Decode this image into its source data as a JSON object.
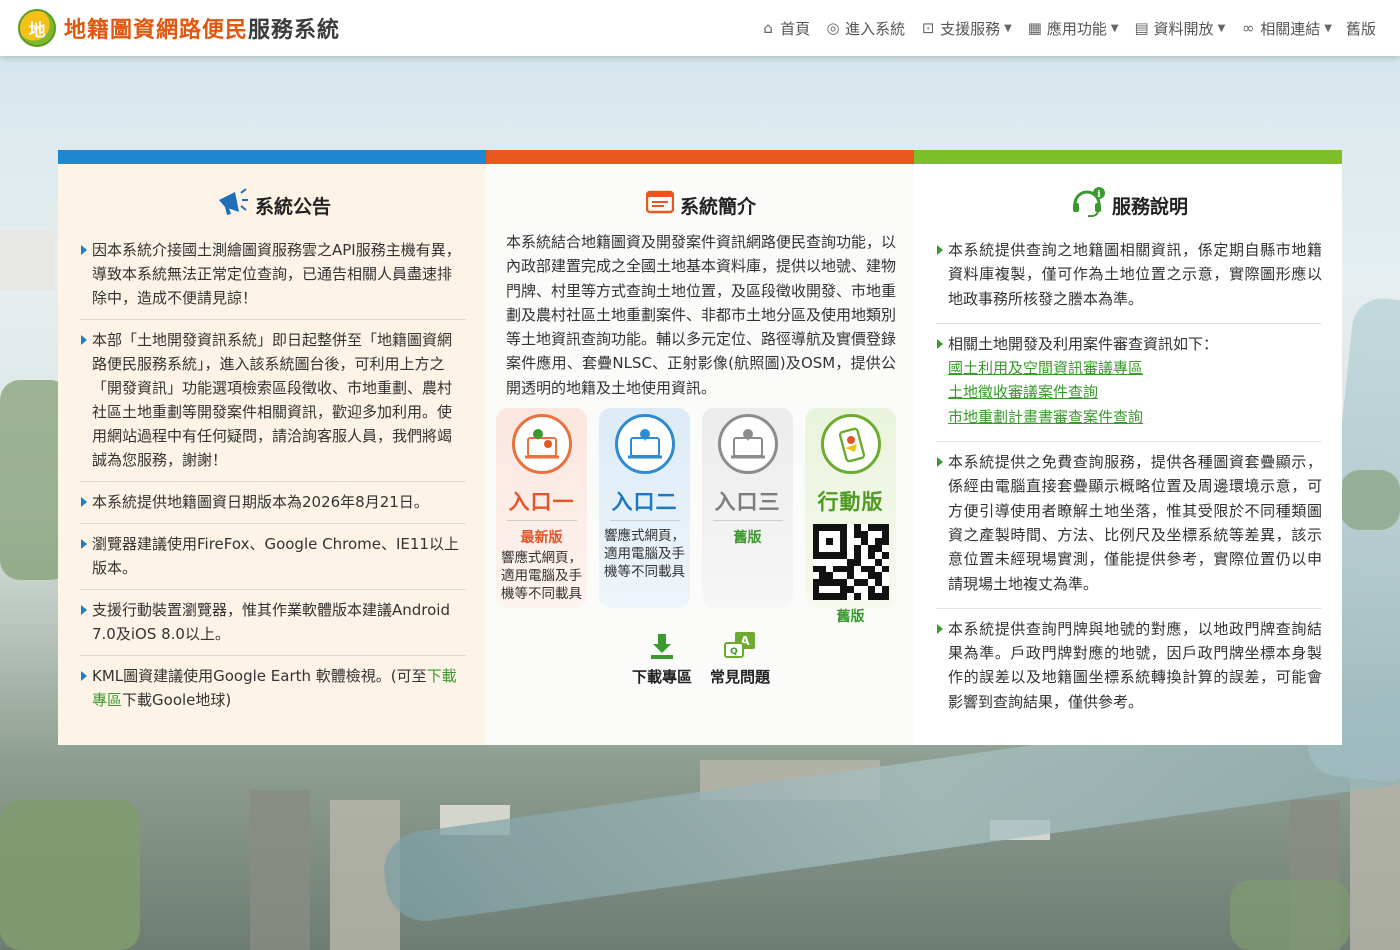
{
  "header": {
    "logo_mark": "地",
    "title_a": "地籍圖資網路便民",
    "title_b": "服務系統",
    "nav": [
      {
        "label": "首頁",
        "icon": "home-icon",
        "has_menu": false
      },
      {
        "label": "進入系統",
        "icon": "search-location-icon",
        "has_menu": false
      },
      {
        "label": "支援服務",
        "icon": "support-icon",
        "has_menu": true
      },
      {
        "label": "應用功能",
        "icon": "grid-icon",
        "has_menu": true
      },
      {
        "label": "資料開放",
        "icon": "open-data-icon",
        "has_menu": true
      },
      {
        "label": "相關連結",
        "icon": "link-icon",
        "has_menu": true
      },
      {
        "label": "舊版",
        "icon": "",
        "has_menu": false
      }
    ]
  },
  "colors": {
    "bar_blue": "#1e88d0",
    "bar_orange": "#e8571f",
    "bar_green": "#7cbf2b",
    "accent_green": "#3a9a2e",
    "accent_red": "#e3562a"
  },
  "announcements": {
    "title": "系統公告",
    "items": [
      "因本系統介接國土測繪圖資服務雲之API服務主機有異，導致本系統無法正常定位查詢，已通告相關人員盡速排除中，造成不便請見諒！",
      "本部「土地開發資訊系統」即日起整併至「地籍圖資網路便民服務系統」，進入該系統圖台後，可利用上方之「開發資訊」功能選項檢索區段徵收、市地重劃、農村社區土地重劃等開發案件相關資訊，歡迎多加利用。使用網站過程中有任何疑問，請洽詢客服人員，我們將竭誠為您服務，謝謝！",
      "本系統提供地籍圖資日期版本為2026年8月21日。",
      "瀏覽器建議使用FireFox、Google Chrome、IE11以上版本。",
      "支援行動裝置瀏覽器，惟其作業軟體版本建議Android 7.0及iOS 8.0以上。"
    ],
    "kml_prefix": "KML圖資建議使用Google Earth 軟體檢視。(可至",
    "kml_link": "下載專區",
    "kml_suffix": "下載Goole地球)"
  },
  "intro": {
    "title": "系統簡介",
    "text": "本系統結合地籍圖資及開發案件資訊網路便民查詢功能，以內政部建置完成之全國土地基本資料庫，提供以地號、建物門牌、村里等方式查詢土地位置，及區段徵收開發、市地重劃及農村社區土地重劃案件、非都市土地分區及使用地類別等土地資訊查詢功能。輔以多元定位、路徑導航及實價登錄案件應用、套疊NLSC、正射影像(航照圖)及OSM，提供公開透明的地籍及土地使用資訊。",
    "entries": [
      {
        "name": "入口一",
        "tag": "最新版",
        "desc": "響應式網頁，適用電腦及手機等不同載具"
      },
      {
        "name": "入口二",
        "tag": "",
        "desc": "響應式網頁，適用電腦及手機等不同載具"
      },
      {
        "name": "入口三",
        "tag": "舊版",
        "desc": ""
      },
      {
        "name": "行動版",
        "tag": "舊版",
        "desc": ""
      }
    ],
    "quick": [
      {
        "label": "下載專區"
      },
      {
        "label": "常見問題"
      }
    ]
  },
  "services": {
    "title": "服務說明",
    "items": [
      "本系統提供查詢之地籍圖相關資訊，係定期自縣市地籍資料庫複製，僅可作為土地位置之示意，實際圖形應以地政事務所核發之謄本為準。",
      "相關土地開發及利用案件審查資訊如下：",
      "本系統提供之免費查詢服務，提供各種圖資套疊顯示，係經由電腦直接套疊顯示概略位置及周邊環境示意，可方便引導使用者瞭解土地坐落，惟其受限於不同種類圖資之產製時間、方法、比例尺及坐標系統等差異，該示意位置未經現場實測，僅能提供參考，實際位置仍以申請現場土地複丈為準。",
      "本系統提供查詢門牌與地號的對應，以地政門牌查詢結果為準。戶政門牌對應的地號，因戶政門牌坐標本身製作的誤差以及地籍圖坐標系統轉換計算的誤差，可能會影響到查詢結果，僅供參考。"
    ],
    "links": [
      "國土利用及空間資訊審議專區",
      "土地徵收審議案件查詢",
      "市地重劃計畫書審查案件查詢"
    ]
  }
}
